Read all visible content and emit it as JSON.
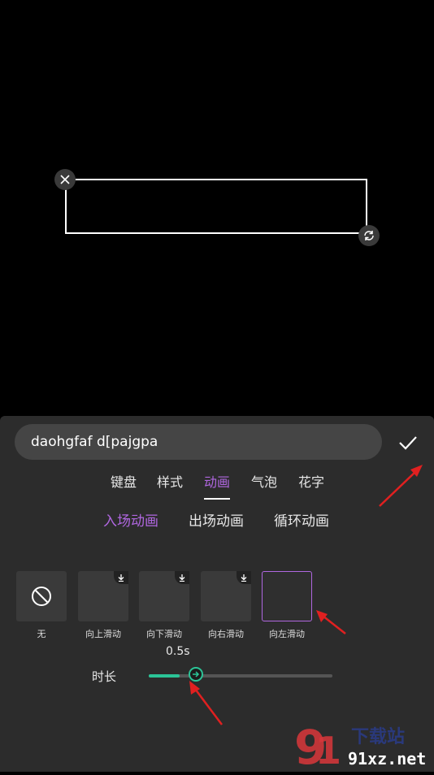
{
  "text_input": {
    "value": "daohgfaf d[pajgpa"
  },
  "tabs": [
    {
      "label": "键盘",
      "active": false
    },
    {
      "label": "样式",
      "active": false
    },
    {
      "label": "动画",
      "active": true
    },
    {
      "label": "气泡",
      "active": false
    },
    {
      "label": "花字",
      "active": false
    }
  ],
  "subtabs": [
    {
      "label": "入场动画",
      "active": true
    },
    {
      "label": "出场动画",
      "active": false
    },
    {
      "label": "循环动画",
      "active": false
    }
  ],
  "animations": [
    {
      "label": "无",
      "icon": "none-icon"
    },
    {
      "label": "向上滑动",
      "icon": "download-icon"
    },
    {
      "label": "向下滑动",
      "icon": "download-icon"
    },
    {
      "label": "向右滑动",
      "icon": "download-icon"
    },
    {
      "label": "向左滑动",
      "selected": true
    }
  ],
  "duration": {
    "label": "时长",
    "value": "0.5s",
    "fraction": 0.17
  },
  "colors": {
    "accent": "#b067e0",
    "slider": "#2bc497",
    "annotation_arrow": "#e02020"
  },
  "watermark": {
    "text": "91xz.net",
    "cn_text": "下载站"
  }
}
